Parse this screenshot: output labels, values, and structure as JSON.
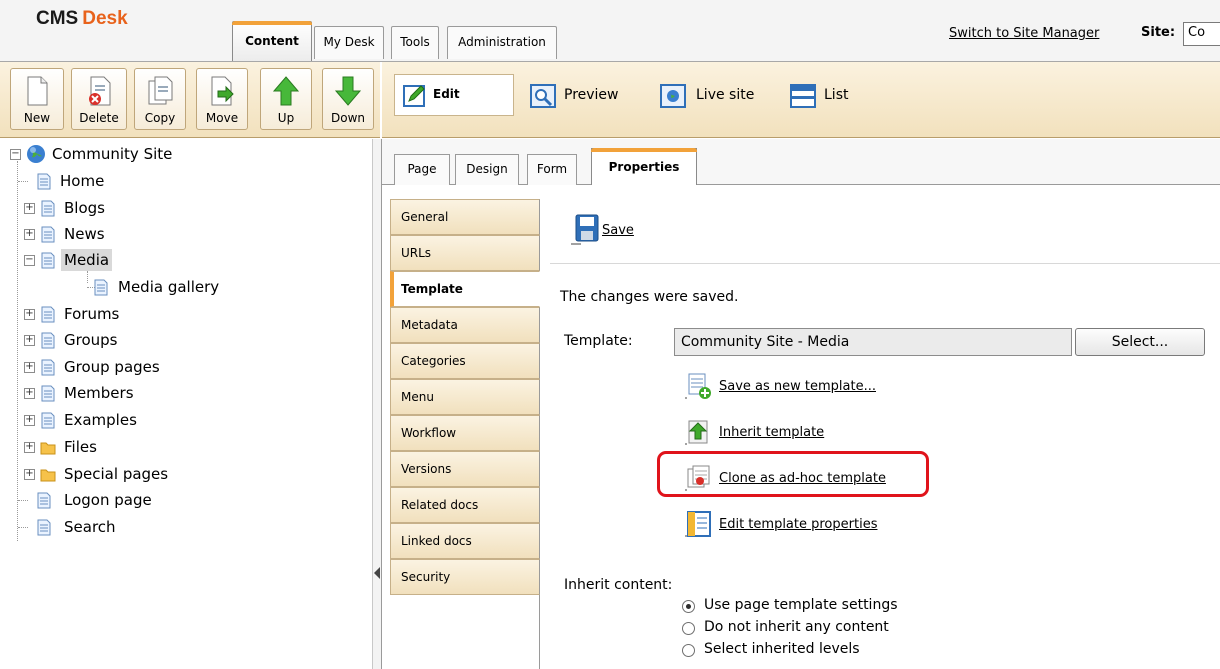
{
  "header": {
    "logo_brand": "CMS",
    "logo_desk": "Desk",
    "tabs": [
      {
        "label": "Content"
      },
      {
        "label": "My Desk"
      },
      {
        "label": "Tools"
      },
      {
        "label": "Administration"
      }
    ],
    "switch_link": "Switch to Site Manager",
    "site_label": "Site:",
    "site_value": "Co"
  },
  "left_toolbar": {
    "buttons": [
      {
        "label": "New",
        "icon": "new-document-icon"
      },
      {
        "label": "Delete",
        "icon": "delete-document-icon"
      },
      {
        "label": "Copy",
        "icon": "copy-document-icon"
      },
      {
        "label": "Move",
        "icon": "move-document-icon"
      },
      {
        "label": "Up",
        "icon": "arrow-up-icon"
      },
      {
        "label": "Down",
        "icon": "arrow-down-icon"
      }
    ]
  },
  "tree": {
    "root": "Community Site",
    "items": [
      {
        "label": "Home"
      },
      {
        "label": "Blogs"
      },
      {
        "label": "News"
      },
      {
        "label": "Media"
      },
      {
        "label": "Media gallery"
      },
      {
        "label": "Forums"
      },
      {
        "label": "Groups"
      },
      {
        "label": "Group pages"
      },
      {
        "label": "Members"
      },
      {
        "label": "Examples"
      },
      {
        "label": "Files"
      },
      {
        "label": "Special pages"
      },
      {
        "label": "Logon page"
      },
      {
        "label": "Search"
      }
    ]
  },
  "modes": {
    "edit": "Edit",
    "preview": "Preview",
    "live_site": "Live site",
    "list": "List"
  },
  "subtabs": [
    {
      "label": "Page"
    },
    {
      "label": "Design"
    },
    {
      "label": "Form"
    },
    {
      "label": "Properties"
    }
  ],
  "vtabs": [
    {
      "label": "General"
    },
    {
      "label": "URLs"
    },
    {
      "label": "Template"
    },
    {
      "label": "Metadata"
    },
    {
      "label": "Categories"
    },
    {
      "label": "Menu"
    },
    {
      "label": "Workflow"
    },
    {
      "label": "Versions"
    },
    {
      "label": "Related docs"
    },
    {
      "label": "Linked docs"
    },
    {
      "label": "Security"
    }
  ],
  "content": {
    "save_label": "Save",
    "message": "The changes were saved.",
    "template_label": "Template:",
    "template_value": "Community Site - Media",
    "select_button": "Select...",
    "actions": {
      "save_new": "Save as new template...",
      "inherit": "Inherit template",
      "clone": "Clone as ad-hoc template",
      "edit_props": "Edit template properties"
    },
    "inherit_label": "Inherit content:",
    "radios": [
      {
        "label": "Use page template settings",
        "selected": true
      },
      {
        "label": "Do not inherit any content",
        "selected": false
      },
      {
        "label": "Select inherited levels",
        "selected": false
      }
    ]
  },
  "colors": {
    "accent_orange": "#f2a23a",
    "highlight_red": "#e0131b",
    "toolbar_beige": "#f2e1bd"
  }
}
